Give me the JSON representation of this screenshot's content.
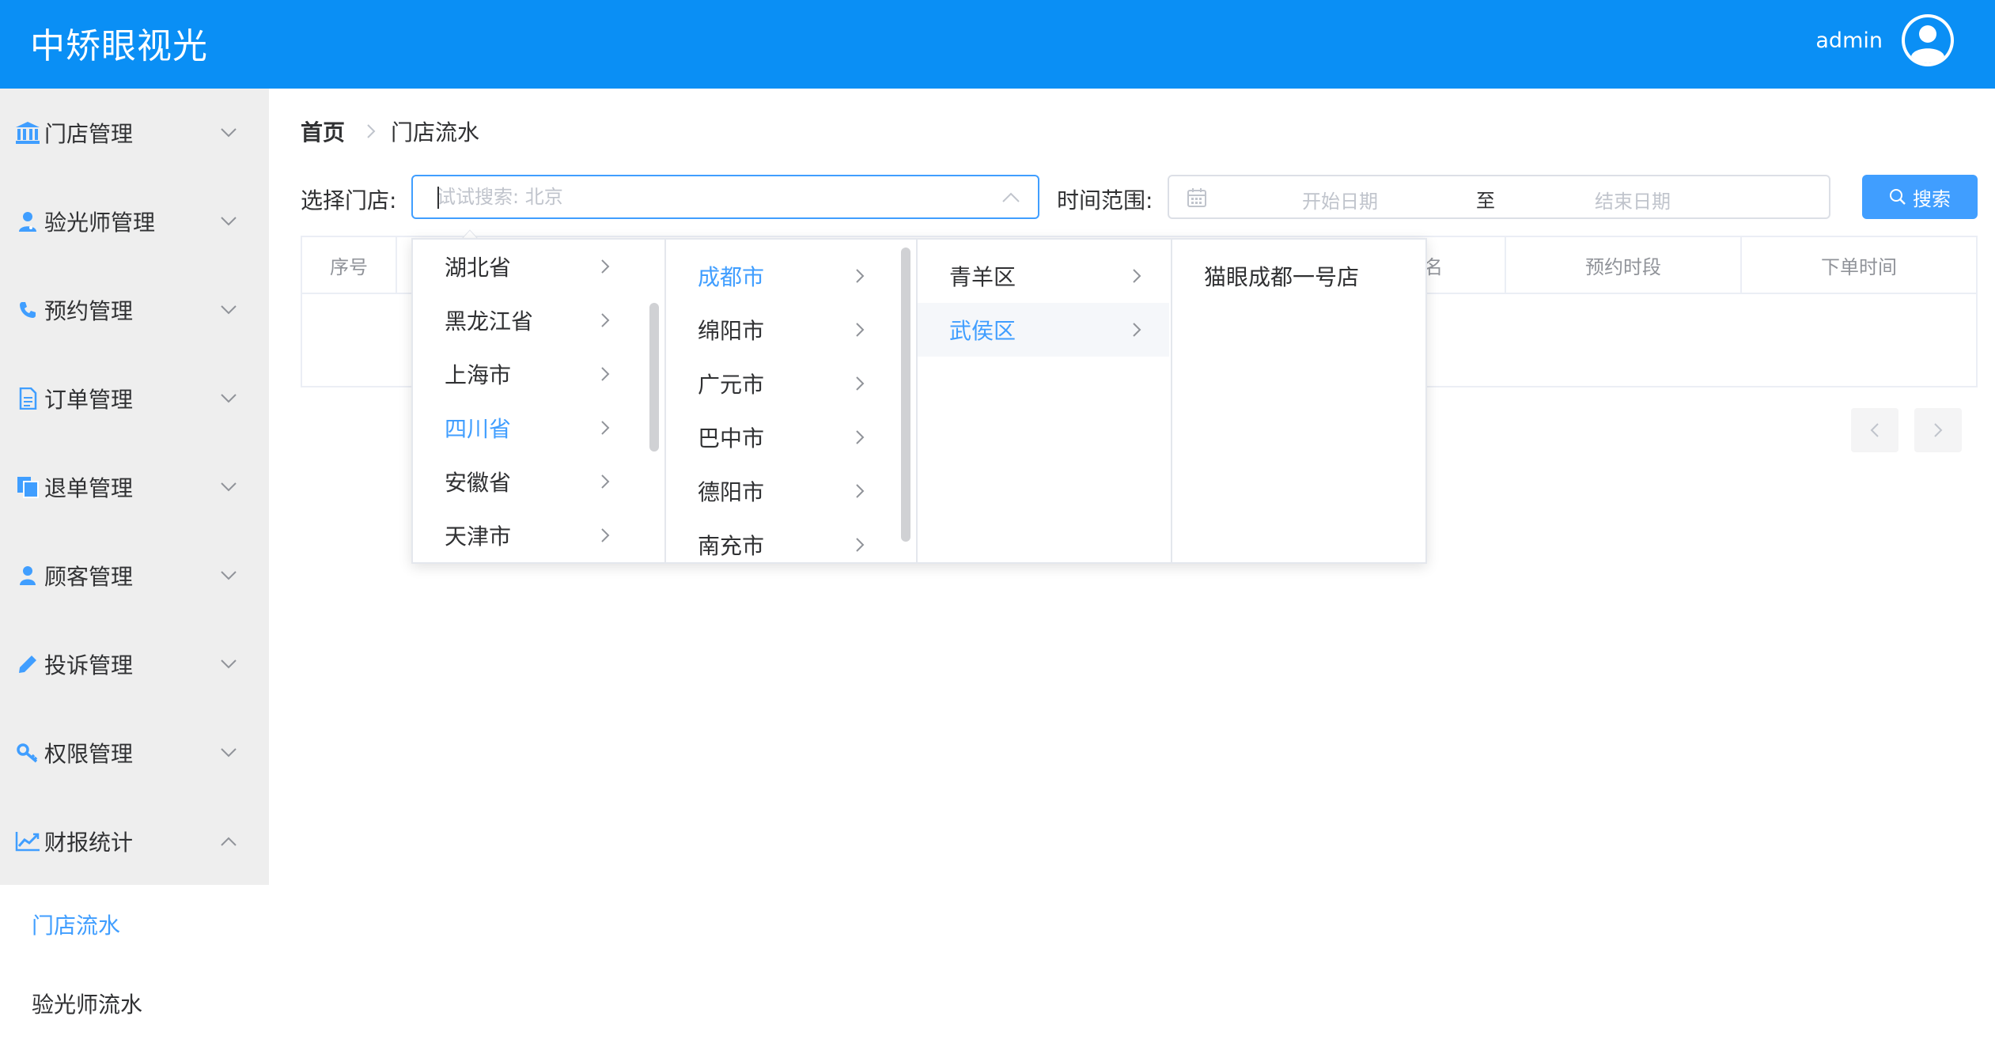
{
  "header": {
    "brand": "中矫眼视光",
    "username": "admin"
  },
  "sidebar": {
    "items": [
      {
        "label": "门店管理",
        "icon": "bank-icon"
      },
      {
        "label": "验光师管理",
        "icon": "user-doctor-icon"
      },
      {
        "label": "预约管理",
        "icon": "phone-icon"
      },
      {
        "label": "订单管理",
        "icon": "document-icon"
      },
      {
        "label": "退单管理",
        "icon": "copy-icon"
      },
      {
        "label": "顾客管理",
        "icon": "user-icon"
      },
      {
        "label": "投诉管理",
        "icon": "pencil-icon"
      },
      {
        "label": "权限管理",
        "icon": "key-icon"
      },
      {
        "label": "财报统计",
        "icon": "trend-chart-icon"
      }
    ],
    "submenu": [
      {
        "label": "门店流水",
        "active": true
      },
      {
        "label": "验光师流水",
        "active": false
      }
    ]
  },
  "breadcrumb": {
    "home": "首页",
    "current": "门店流水"
  },
  "filters": {
    "store_label": "选择门店:",
    "store_placeholder": "试试搜索: 北京",
    "time_label": "时间范围:",
    "start_placeholder": "开始日期",
    "range_separator": "至",
    "end_placeholder": "结束日期",
    "search_button": "搜索"
  },
  "table": {
    "columns": [
      "序号",
      "名",
      "预约时段",
      "下单时间"
    ]
  },
  "cascader": {
    "provinces": [
      "湖北省",
      "黑龙江省",
      "上海市",
      "四川省",
      "安徽省",
      "天津市"
    ],
    "cities": [
      "成都市",
      "绵阳市",
      "广元市",
      "巴中市",
      "德阳市",
      "南充市"
    ],
    "districts": [
      "青羊区",
      "武侯区"
    ],
    "stores": [
      "猫眼成都一号店"
    ],
    "selected_province": "四川省",
    "selected_city": "成都市",
    "selected_district": "武侯区"
  },
  "colors": {
    "header_bg": "#0a8ff5",
    "accent": "#409eff",
    "sidebar_bg": "#eeeeee"
  }
}
